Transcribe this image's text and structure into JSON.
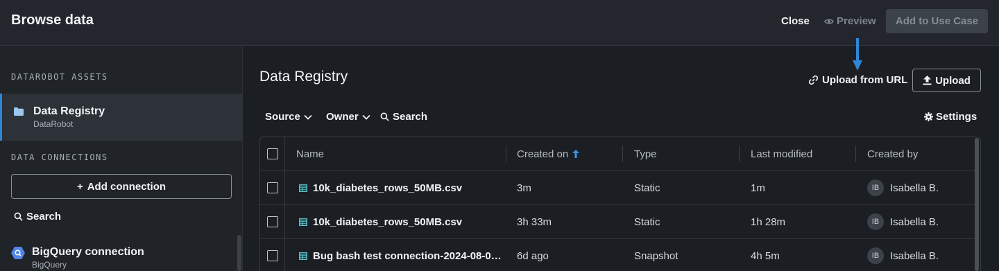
{
  "header": {
    "title": "Browse data",
    "close_label": "Close",
    "preview_label": "Preview",
    "add_label": "Add to Use Case"
  },
  "sidebar": {
    "assets_label": "DATAROBOT ASSETS",
    "registry": {
      "name": "Data Registry",
      "sub": "DataRobot"
    },
    "connections_label": "DATA CONNECTIONS",
    "add_connection_label": "Add connection",
    "search_label": "Search",
    "connection": {
      "name": "BigQuery connection",
      "sub": "BigQuery"
    }
  },
  "main": {
    "title": "Data Registry",
    "upload_url_label": "Upload from URL",
    "upload_label": "Upload",
    "filters": {
      "source": "Source",
      "owner": "Owner",
      "search": "Search"
    },
    "settings_label": "Settings"
  },
  "table": {
    "columns": [
      "Name",
      "Created on",
      "Type",
      "Last modified",
      "Created by"
    ],
    "rows": [
      {
        "name": "10k_diabetes_rows_50MB.csv",
        "created": "3m",
        "type": "Static",
        "modified": "1m",
        "initials": "IB",
        "by": "Isabella B."
      },
      {
        "name": "10k_diabetes_rows_50MB.csv",
        "created": "3h 33m",
        "type": "Static",
        "modified": "1h 28m",
        "initials": "IB",
        "by": "Isabella B."
      },
      {
        "name": "Bug bash test connection-2024-08-0…",
        "created": "6d ago",
        "type": "Snapshot",
        "modified": "4h 5m",
        "initials": "IB",
        "by": "Isabella B."
      }
    ]
  },
  "colors": {
    "accent": "#2f86d6",
    "bg": "#1b1f24",
    "header_bg": "#23272d"
  }
}
